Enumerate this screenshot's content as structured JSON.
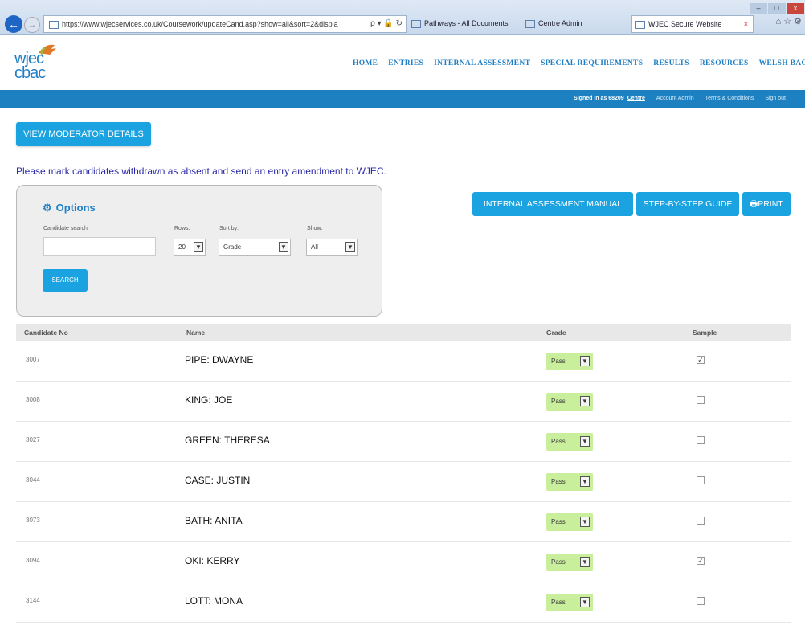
{
  "browser": {
    "address": "https://www.wjecservices.co.uk/Coursework/updateCand.asp?show=all&sort=2&displa",
    "address_tools": "ρ ▾ 🔒 ↻",
    "tabs": [
      "Pathways - All Documents",
      "Centre Admin",
      "WJEC Secure Website"
    ],
    "active_tab_close": "×",
    "right_icons": "⌂ ☆ ⚙",
    "back": "←",
    "forward": "→"
  },
  "logo": {
    "line1": "wjec",
    "line2": "cbac"
  },
  "nav": [
    "HOME",
    "ENTRIES",
    "INTERNAL ASSESSMENT",
    "SPECIAL REQUIREMENTS",
    "RESULTS",
    "RESOURCES",
    "WELSH BAC"
  ],
  "topbar": {
    "signed_in": "Signed in as 68209",
    "user": "Centre",
    "links": [
      "Account Admin",
      "Terms & Conditions",
      "Sign out"
    ]
  },
  "buttons": {
    "view_moderator": "VIEW MODERATOR DETAILS",
    "manual": "INTERNAL ASSESSMENT MANUAL",
    "guide": "STEP-BY-STEP GUIDE",
    "print": "PRINT"
  },
  "notice": "Please mark candidates withdrawn as absent and send an entry amendment to WJEC.",
  "options": {
    "title": "Options",
    "search_label": "Candidate search",
    "rows_label": "Rows:",
    "rows_value": "20",
    "sort_label": "Sort by:",
    "sort_value": "Grade",
    "show_label": "Show:",
    "show_value": "All",
    "search_button": "SEARCH"
  },
  "table": {
    "headers": [
      "Candidate No",
      "Name",
      "Grade",
      "Sample"
    ],
    "rows": [
      {
        "cand": "3007",
        "name": "PIPE: DWAYNE",
        "grade": "Pass",
        "sample": "✓"
      },
      {
        "cand": "3008",
        "name": "KING: JOE",
        "grade": "Pass",
        "sample": ""
      },
      {
        "cand": "3027",
        "name": "GREEN: THERESA",
        "grade": "Pass",
        "sample": ""
      },
      {
        "cand": "3044",
        "name": "CASE: JUSTIN",
        "grade": "Pass",
        "sample": ""
      },
      {
        "cand": "3073",
        "name": "BATH: ANITA",
        "grade": "Pass",
        "sample": ""
      },
      {
        "cand": "3094",
        "name": "OKI: KERRY",
        "grade": "Pass",
        "sample": "✓"
      },
      {
        "cand": "3144",
        "name": "LOTT: MONA",
        "grade": "Pass",
        "sample": ""
      }
    ]
  },
  "colors": {
    "accent": "#1f7fc5",
    "button": "#1aa3e0",
    "grade_bg": "#c9ee9c"
  }
}
